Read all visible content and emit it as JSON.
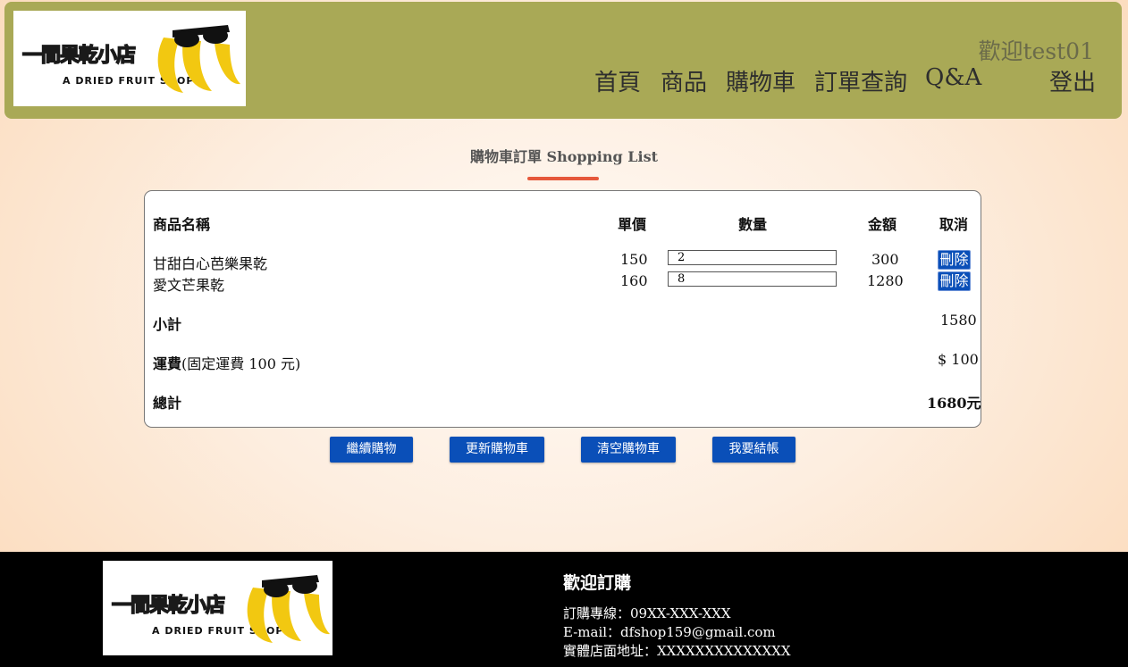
{
  "logo": {
    "title": "一間果乾小店",
    "subtitle": "A DRIED FRUIT SHOP"
  },
  "header": {
    "welcome": "歡迎test01",
    "nav": [
      "首頁",
      "商品",
      "購物車",
      "訂單查詢",
      "Q&A"
    ],
    "logout": "登出"
  },
  "page": {
    "title": "購物車訂單 Shopping List"
  },
  "cart": {
    "headers": {
      "name": "商品名稱",
      "price": "單價",
      "qty": "數量",
      "amount": "金額",
      "cancel": "取消"
    },
    "items": [
      {
        "name": "甘甜白心芭樂果乾",
        "price": "150",
        "qty": "2",
        "amount": "300",
        "delete": "刪除"
      },
      {
        "name": "愛文芒果乾",
        "price": "160",
        "qty": "8",
        "amount": "1280",
        "delete": "刪除"
      }
    ],
    "subtotal_label": "小計",
    "subtotal": "1580",
    "shipping_label": "運費",
    "shipping_note": "(固定運費 100 元)",
    "shipping": "$ 100",
    "total_label": "總計",
    "total": "1680元"
  },
  "actions": {
    "continue": "繼續購物",
    "update": "更新購物車",
    "clear": "清空購物車",
    "checkout": "我要結帳"
  },
  "footer": {
    "heading": "歡迎訂購",
    "phone": "訂購專線：09XX-XXX-XXX",
    "email": "E-mail：dfshop159@gmail.com",
    "address": "實體店面地址：XXXXXXXXXXXXXX"
  },
  "colors": {
    "header_bg": "#a9a956",
    "button": "#0a4fb8",
    "accent": "#e6583b",
    "logo_yellow": "#f2c811"
  }
}
